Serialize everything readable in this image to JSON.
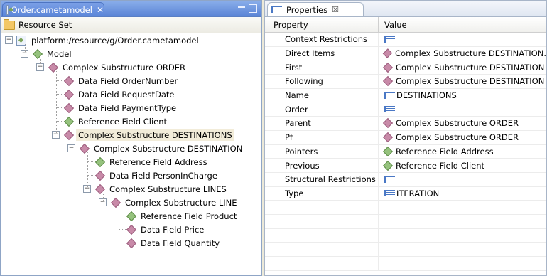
{
  "left": {
    "tab_label": "Order.cametamodel",
    "tab_close": "✕",
    "toolbar_label": "Resource Set",
    "tree": [
      {
        "label": "platform:/resource/g/Order.cametamodel",
        "depth": 0,
        "icon": "model-file-icon",
        "expander": "minus",
        "selected": false
      },
      {
        "label": "Model",
        "depth": 1,
        "icon": "green-diamond-icon",
        "expander": "minus",
        "selected": false
      },
      {
        "label": "Complex Substructure ORDER",
        "depth": 2,
        "icon": "pink-diamond-icon",
        "expander": "minus",
        "selected": false
      },
      {
        "label": "Data Field OrderNumber",
        "depth": 3,
        "icon": "pink-diamond-icon",
        "expander": "",
        "selected": false
      },
      {
        "label": "Data Field RequestDate",
        "depth": 3,
        "icon": "pink-diamond-icon",
        "expander": "",
        "selected": false
      },
      {
        "label": "Data Field PaymentType",
        "depth": 3,
        "icon": "pink-diamond-icon",
        "expander": "",
        "selected": false
      },
      {
        "label": "Reference Field Client",
        "depth": 3,
        "icon": "green-diamond-icon",
        "expander": "",
        "selected": false
      },
      {
        "label": "Complex Substructure DESTINATIONS",
        "depth": 3,
        "icon": "pink-diamond-icon",
        "expander": "minus",
        "selected": true
      },
      {
        "label": "Complex Substructure DESTINATION",
        "depth": 4,
        "icon": "pink-diamond-icon",
        "expander": "minus",
        "selected": false
      },
      {
        "label": "Reference Field Address",
        "depth": 5,
        "icon": "green-diamond-icon",
        "expander": "",
        "selected": false
      },
      {
        "label": "Data Field PersonInCharge",
        "depth": 5,
        "icon": "pink-diamond-icon",
        "expander": "",
        "selected": false
      },
      {
        "label": "Complex Substructure LINES",
        "depth": 5,
        "icon": "pink-diamond-icon",
        "expander": "minus",
        "selected": false
      },
      {
        "label": "Complex Substructure LINE",
        "depth": 6,
        "icon": "pink-diamond-icon",
        "expander": "minus",
        "selected": false
      },
      {
        "label": "Reference Field Product",
        "depth": 7,
        "icon": "green-diamond-icon",
        "expander": "",
        "selected": false
      },
      {
        "label": "Data Field Price",
        "depth": 7,
        "icon": "pink-diamond-icon",
        "expander": "",
        "selected": false
      },
      {
        "label": "Data Field Quantity",
        "depth": 7,
        "icon": "pink-diamond-icon",
        "expander": "",
        "selected": false
      }
    ]
  },
  "right": {
    "tab_label": "Properties",
    "tab_close": "☒",
    "col_property": "Property",
    "col_value": "Value",
    "rows": [
      {
        "name": "Context Restrictions",
        "icon": "list-icon",
        "value": ""
      },
      {
        "name": "Direct Items",
        "icon": "pink-diamond-icon",
        "value": "Complex Substructure DESTINATION."
      },
      {
        "name": "First",
        "icon": "pink-diamond-icon",
        "value": "Complex Substructure DESTINATION"
      },
      {
        "name": "Following",
        "icon": "pink-diamond-icon",
        "value": "Complex Substructure DESTINATION"
      },
      {
        "name": "Name",
        "icon": "list-icon",
        "value": "DESTINATIONS"
      },
      {
        "name": "Order",
        "icon": "list-icon",
        "value": ""
      },
      {
        "name": "Parent",
        "icon": "pink-diamond-icon",
        "value": "Complex Substructure ORDER"
      },
      {
        "name": "Pf",
        "icon": "pink-diamond-icon",
        "value": "Complex Substructure ORDER"
      },
      {
        "name": "Pointers",
        "icon": "green-diamond-icon",
        "value": "Reference Field Address"
      },
      {
        "name": "Previous",
        "icon": "green-diamond-icon",
        "value": "Reference Field Client"
      },
      {
        "name": "Structural Restrictions",
        "icon": "list-icon",
        "value": ""
      },
      {
        "name": "Type",
        "icon": "list-icon",
        "value": "ITERATION"
      },
      {
        "name": "",
        "icon": "",
        "value": ""
      },
      {
        "name": "",
        "icon": "",
        "value": ""
      },
      {
        "name": "",
        "icon": "",
        "value": ""
      },
      {
        "name": "",
        "icon": "",
        "value": ""
      },
      {
        "name": "",
        "icon": "",
        "value": ""
      }
    ]
  },
  "colors": {
    "selection": "#f2ecd9",
    "tab_active": "#5b86d9",
    "pink_icon": "#c88aa8",
    "green_icon": "#95c27d"
  }
}
